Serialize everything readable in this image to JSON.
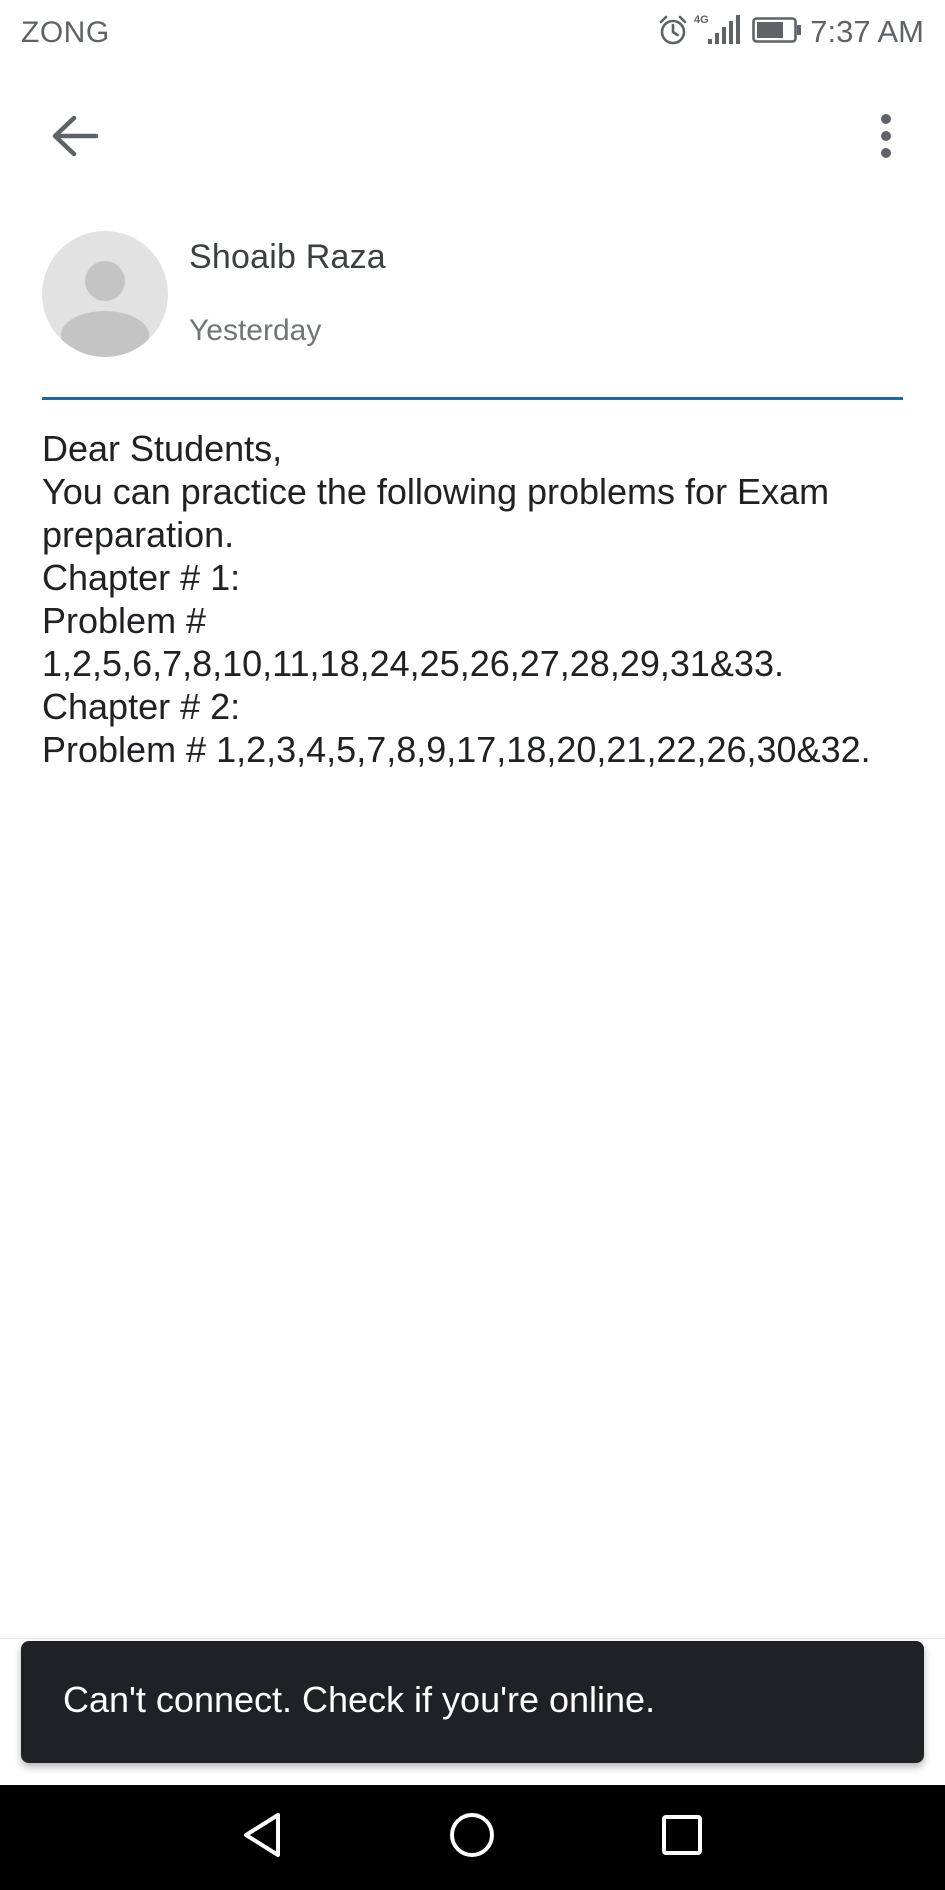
{
  "status_bar": {
    "carrier": "ZONG",
    "network_label": "4G",
    "time": "7:37 AM",
    "icons": [
      "alarm-icon",
      "signal-icon",
      "battery-icon"
    ]
  },
  "app_bar": {
    "icons": [
      "arrow-back-icon",
      "more-vert-icon"
    ]
  },
  "post": {
    "author": "Shoaib Raza",
    "date": "Yesterday",
    "body_lines": [
      "Dear Students,",
      "You can practice the following problems for Exam",
      "preparation.",
      "Chapter # 1:",
      "Problem #",
      "1,2,5,6,7,8,10,11,18,24,25,26,27,28,29,31&33.",
      "Chapter # 2:",
      "Problem # 1,2,3,4,5,7,8,9,17,18,20,21,22,26,30&32."
    ]
  },
  "snackbar": {
    "message": "Can't connect. Check if you're online."
  },
  "nav_bar": {
    "icons": [
      "nav-back-icon",
      "nav-home-icon",
      "nav-recents-icon"
    ]
  },
  "colors": {
    "divider": "#1a6aa6",
    "snackbar_bg": "#202124",
    "nav_bg": "#000000",
    "avatar_bg": "#e2e2e2"
  }
}
